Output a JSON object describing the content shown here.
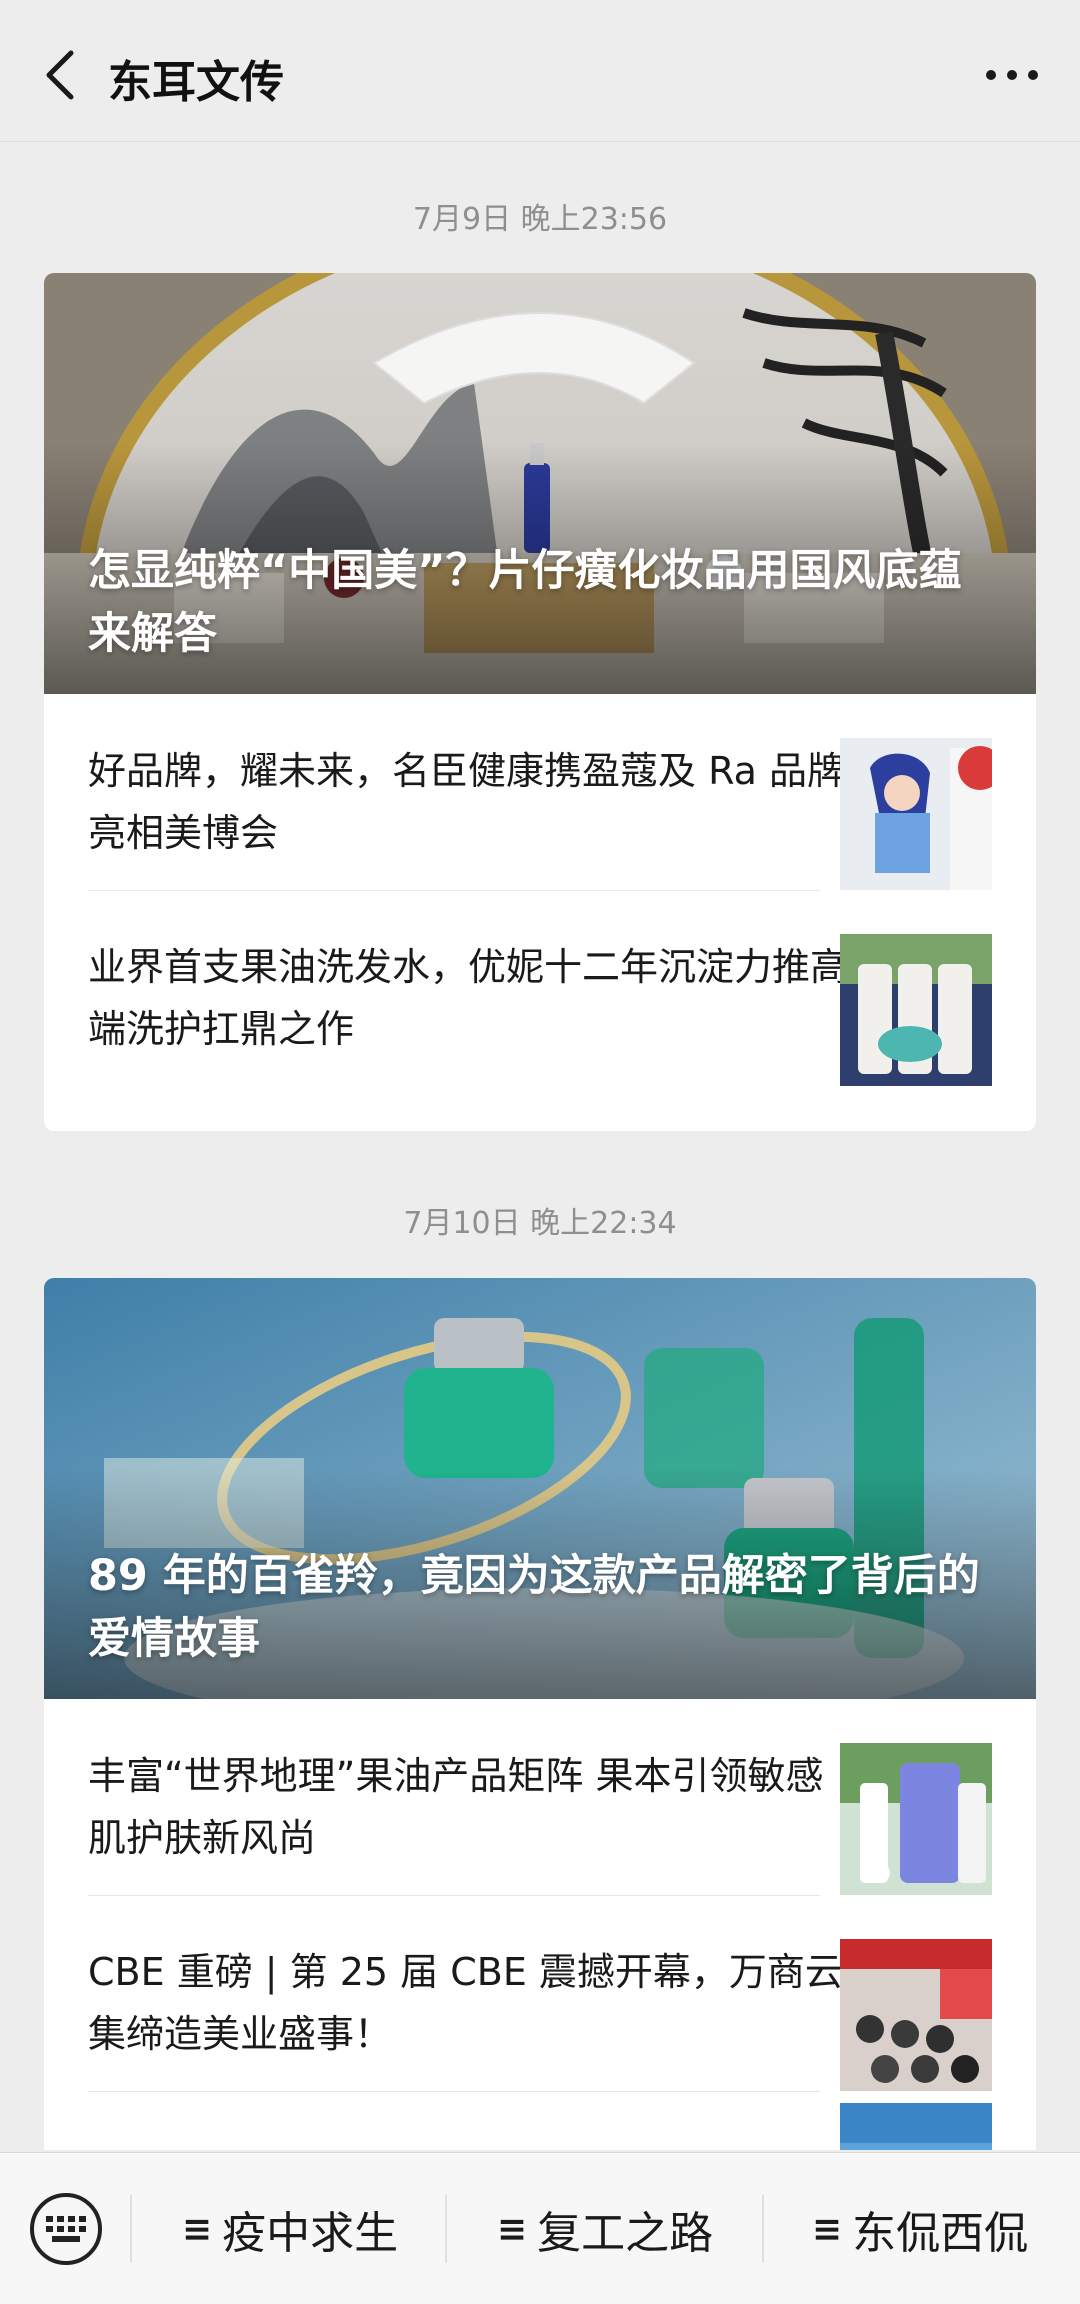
{
  "header": {
    "title": "东耳文传",
    "back_icon": "chevron-left-icon",
    "more_icon": "more-dots-icon"
  },
  "groups": [
    {
      "timestamp": "7月9日 晚上23:56",
      "cover_title": "怎显纯粹“中国美”？片仔癀化妆品用国风底蕴来解答",
      "items": [
        {
          "title": "好品牌，耀未来，名臣健康携盈蔻及 Ra 品牌亮相美博会"
        },
        {
          "title": "业界首支果油洗发水，优妮十二年沉淀力推高端洗护扛鼎之作"
        }
      ]
    },
    {
      "timestamp": "7月10日 晚上22:34",
      "cover_title": "89 年的百雀羚，竟因为这款产品解密了背后的爱情故事",
      "items": [
        {
          "title": "丰富“世界地理”果油产品矩阵 果本引领敏感肌护肤新风尚"
        },
        {
          "title": "CBE 重磅 | 第 25 届 CBE 震撼开幕，万商云集缔造美业盛事！"
        }
      ]
    }
  ],
  "bottom_menu": {
    "keyboard_icon": "keyboard-icon",
    "items": [
      {
        "label": "疫中求生"
      },
      {
        "label": "复工之路"
      },
      {
        "label": "东侃西侃"
      }
    ],
    "menu_glyph": "≡"
  },
  "colors": {
    "background": "#ededed",
    "card": "#ffffff",
    "timestamp": "#8f8f8f"
  }
}
